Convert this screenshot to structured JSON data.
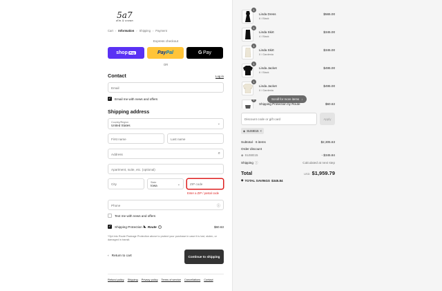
{
  "brand": {
    "mark": "5a7",
    "sub": "elin & ocean"
  },
  "breadcrumb": {
    "cart": "Cart",
    "information": "Information",
    "shipping": "Shipping",
    "payment": "Payment"
  },
  "express": {
    "title": "Express checkout",
    "shop": "shop",
    "shop_pay": "Pay",
    "paypal_a": "Pay",
    "paypal_b": "Pal",
    "gpay_g": "G",
    "gpay": "Pay",
    "or": "OR"
  },
  "contact": {
    "heading": "Contact",
    "login": "Log in",
    "email_placeholder": "Email",
    "email_offers": "Email me with news and offers"
  },
  "shipping": {
    "heading": "Shipping address",
    "country_label": "Country/Region",
    "country_value": "United States",
    "first_name": "First name",
    "last_name": "Last name",
    "address": "Address",
    "apartment": "Apartment, suite, etc. (optional)",
    "city": "City",
    "state_label": "State",
    "state_value": "Iowa",
    "zip": "ZIP code",
    "zip_error": "Enter a ZIP / postal code",
    "phone": "Phone",
    "text_offers": "Text me with news and offers"
  },
  "route": {
    "label": "Shipping Protection",
    "logo": "Route",
    "price": "$60.63",
    "disclaimer": "*Opt into Route Package Protection above to protect your purchase in case it is lost, stolen, or damaged in transit."
  },
  "actions": {
    "return": "Return to cart",
    "continue": "Continue to shipping"
  },
  "footer": [
    "Refund policy",
    "Shipping",
    "Privacy policy",
    "Terms of service",
    "Cancellations",
    "Contact"
  ],
  "items": [
    {
      "name": "Linda Dress",
      "variant": "6 / Black",
      "price": "$565.00",
      "qty": "1"
    },
    {
      "name": "Linda Skirt",
      "variant": "4 / Black",
      "price": "$345.00",
      "qty": "1"
    },
    {
      "name": "Linda Skirt",
      "variant": "0 / Gardenia",
      "price": "$345.00",
      "qty": "1"
    },
    {
      "name": "Linda Jacket",
      "variant": "6 / Black",
      "price": "$495.00",
      "qty": "1"
    },
    {
      "name": "Linda Jacket",
      "variant": "0 / Gardenia",
      "price": "$495.00",
      "qty": "1"
    },
    {
      "name": "Shipping Protection by Route",
      "variant": "",
      "price": "$60.63",
      "qty": "1"
    }
  ],
  "scroll_hint": "Scroll for more items",
  "discount": {
    "placeholder": "Discount code or gift card",
    "apply": "Apply",
    "tag": "SUSIE15"
  },
  "summary": {
    "subtotal_label": "Subtotal · 6 items",
    "subtotal": "$2,305.63",
    "order_discount_label": "Order discount",
    "code": "SUSIE15",
    "discount": "- $345.84",
    "shipping_label": "Shipping",
    "shipping_value": "Calculated at next step",
    "total_label": "Total",
    "currency": "USD",
    "total": "$1,959.79",
    "savings_label": "TOTAL SAVINGS",
    "savings": "$345.84"
  },
  "colors": {
    "shop_pay": "#5a31f4",
    "paypal": "#ffc439",
    "gpay": "#000000",
    "error": "#dd1d1d",
    "primary_button": "#333333"
  }
}
